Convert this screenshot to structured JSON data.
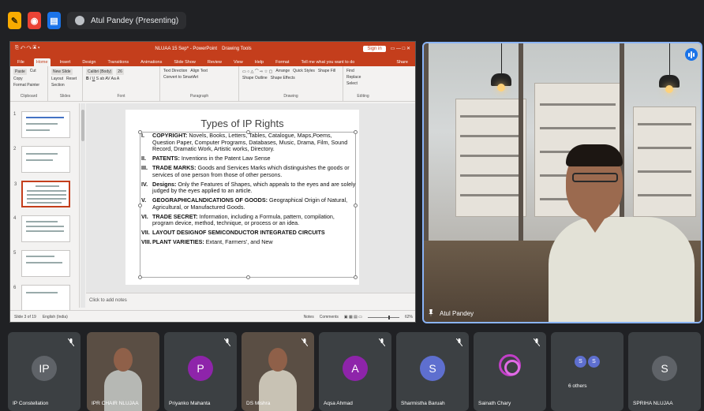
{
  "topbar": {
    "presenter_label": "Atul Pandey (Presenting)"
  },
  "ppt": {
    "doc_name": "NLUAA 15 Sep* - PowerPoint",
    "drawing_tools": "Drawing Tools",
    "signin": "Sign in",
    "share": "Share",
    "menu": [
      "File",
      "Home",
      "Insert",
      "Design",
      "Transitions",
      "Animations",
      "Slide Show",
      "Review",
      "View",
      "Help",
      "Format",
      "Tell me what you want to do"
    ],
    "ribbon": {
      "clipboard": "Clipboard",
      "slides": "Slides",
      "font": "Font",
      "paragraph": "Paragraph",
      "drawing": "Drawing",
      "editing": "Editing",
      "paste": "Paste",
      "cut": "Cut",
      "copy": "Copy",
      "format_painter": "Format Painter",
      "new_slide": "New Slide",
      "layout": "Layout",
      "reset": "Reset",
      "section": "Section",
      "font_name": "Calibri (Body)",
      "font_size": "26",
      "text_direction": "Text Direction",
      "align_text": "Align Text",
      "convert_smartart": "Convert to SmartArt",
      "arrange": "Arrange",
      "quick_styles": "Quick Styles",
      "shape_fill": "Shape Fill",
      "shape_outline": "Shape Outline",
      "shape_effects": "Shape Effects",
      "find": "Find",
      "replace": "Replace",
      "select": "Select"
    },
    "thumb_numbers": [
      "1",
      "2",
      "3",
      "4",
      "5",
      "6"
    ],
    "slide": {
      "title": "Types of IP Rights",
      "items": [
        {
          "num": "I.",
          "head": "COPYRIGHT:",
          "text": " Novels, Books, Letters, Tables, Catalogue, Maps,Poems, Question Paper, Computer Programs, Databases, Music, Drama, Film, Sound Record, Dramatic Work, Artistic works, Directory."
        },
        {
          "num": "II.",
          "head": "PATENTS:",
          "text": " Inventions in the Patent Law Sense"
        },
        {
          "num": "III.",
          "head": "TRADE MARKS:",
          "text": " Goods and Services Marks which distinguishes the goods or services of one person from those of other persons."
        },
        {
          "num": "IV.",
          "head": "Designs:",
          "text": " Only the Features of Shapes, which appeals to the eyes and are solely judged by the eyes applied to an article."
        },
        {
          "num": "V.",
          "head": "GEOGRAPHICALNDICATIONS OF GOODS:",
          "text": " Geographical Origin of Natural, Agricultural, or Manufactured Goods."
        },
        {
          "num": "VI.",
          "head": "TRADE SECRET:",
          "text": " Information, including a Formula, pattern, compilation, program device, method, technique, or process or an idea."
        },
        {
          "num": "VII.",
          "head": "LAYOUT DESIGNOF SEMICONDUCTOR INTEGRATED CIRCUITS",
          "text": ""
        },
        {
          "num": "VIII.",
          "head": "PLANT VARIETIES:",
          "text": " Extant, Farmers', and New"
        }
      ]
    },
    "notes_placeholder": "Click to add notes",
    "status": {
      "slide_of": "Slide 3 of 19",
      "language": "English (India)",
      "notes": "Notes",
      "comments": "Comments",
      "zoom": "62%"
    }
  },
  "main_video": {
    "name": "Atul Pandey"
  },
  "participants": [
    {
      "name": "IP Constellation",
      "initials": "IP",
      "color": "#5f6368",
      "type": "avatar"
    },
    {
      "name": "IPR CHAIR NLUJAA",
      "initials": "",
      "color": "",
      "type": "video"
    },
    {
      "name": "Priyanko Mahanta",
      "initials": "P",
      "color": "#8e24aa",
      "type": "avatar"
    },
    {
      "name": "DS Mishra",
      "initials": "",
      "color": "",
      "type": "video"
    },
    {
      "name": "Aqsa Ahmad",
      "initials": "A",
      "color": "#8e24aa",
      "type": "avatar"
    },
    {
      "name": "Sharmistha Baruah",
      "initials": "S",
      "color": "#5e6fcf",
      "type": "avatar"
    },
    {
      "name": "Sainath Chary",
      "initials": "",
      "color": "#c13fc7",
      "type": "ring"
    },
    {
      "name": "6 others",
      "initials": "S",
      "color": "#5e6fcf",
      "type": "others"
    },
    {
      "name": "SPRIHA NLUJAA",
      "initials": "S",
      "color": "#5f6368",
      "type": "avatar"
    }
  ]
}
